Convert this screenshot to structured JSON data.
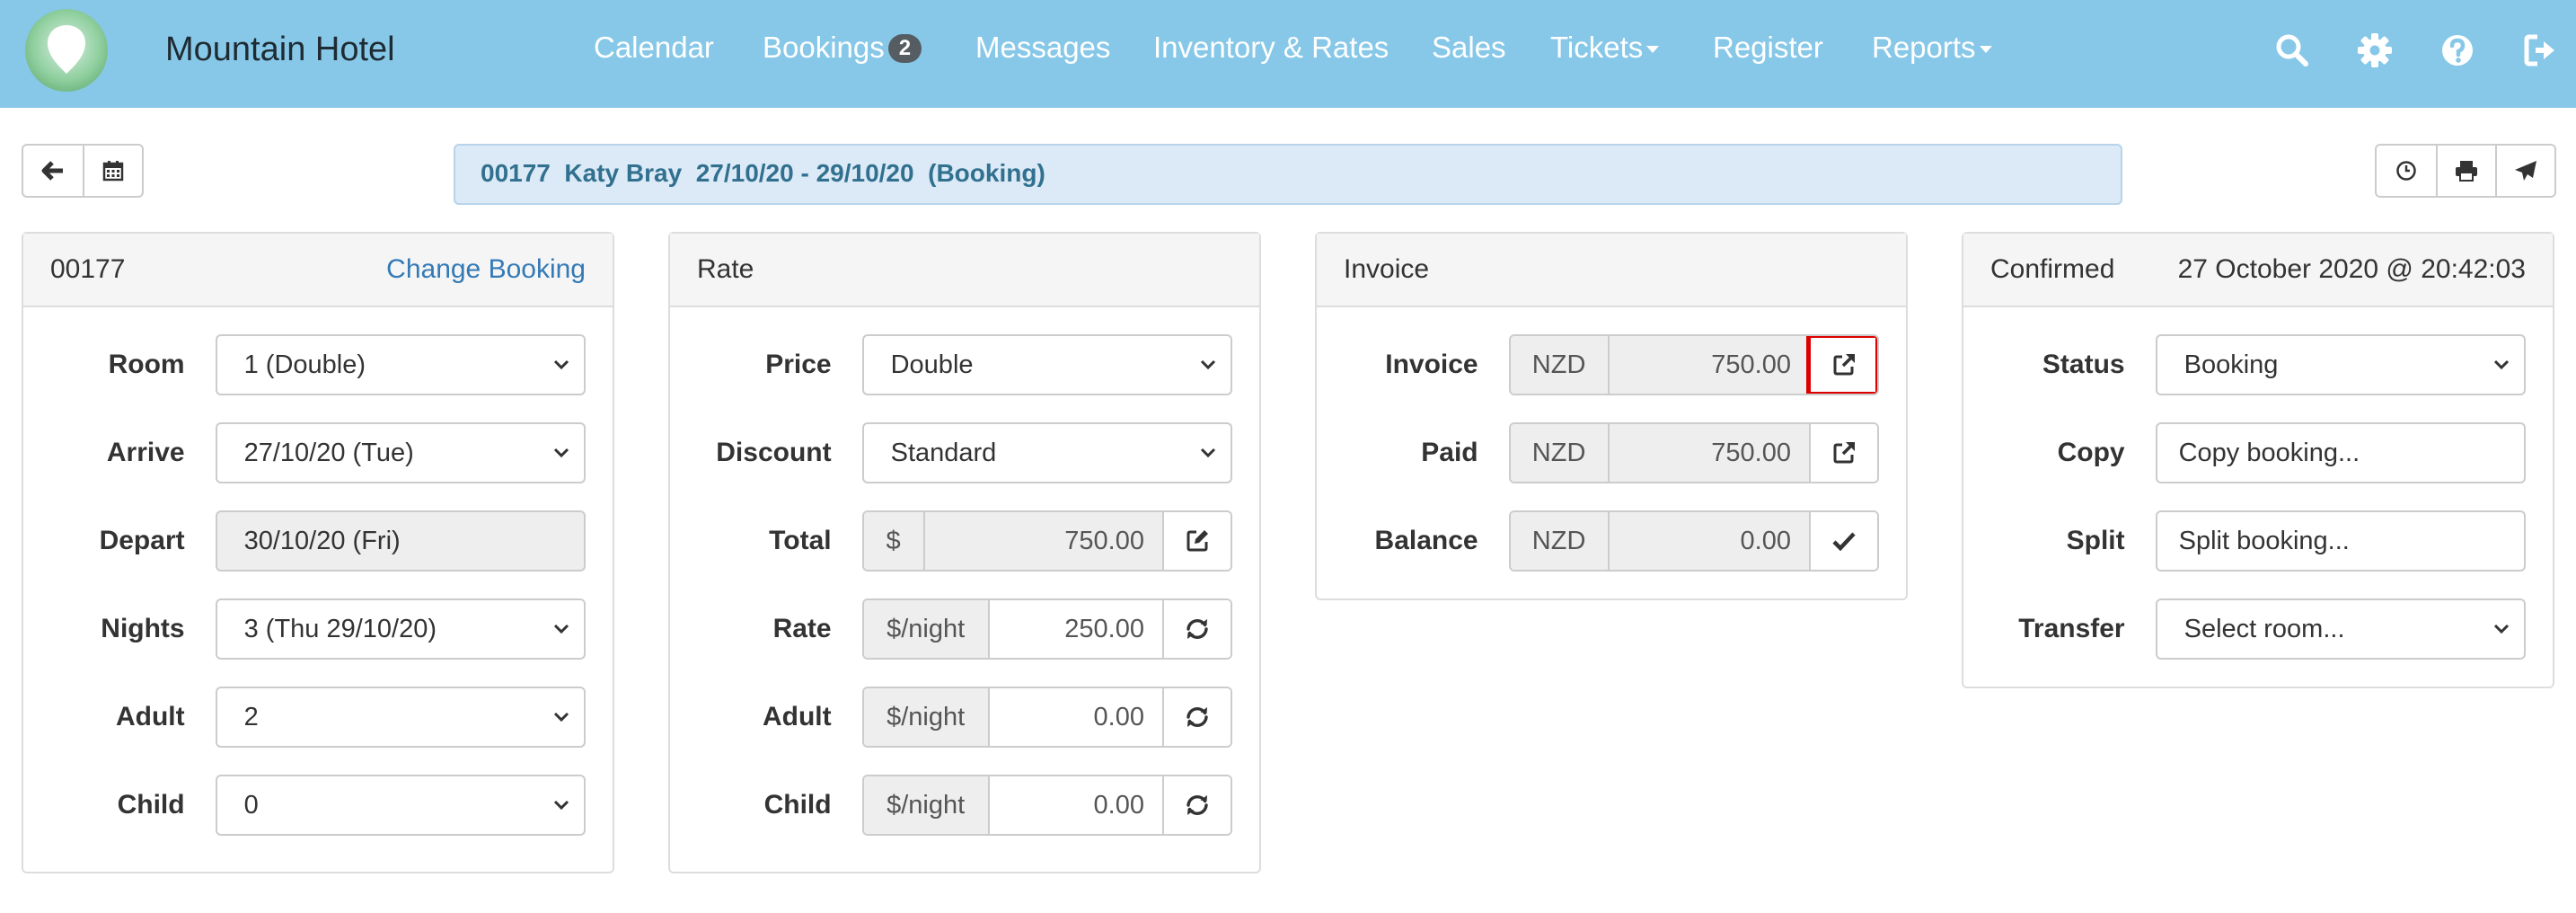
{
  "app": {
    "name": "Mountain Hotel",
    "nav": [
      {
        "label": "Calendar"
      },
      {
        "label": "Bookings",
        "badge": "2"
      },
      {
        "label": "Messages"
      },
      {
        "label": "Inventory & Rates"
      },
      {
        "label": "Sales"
      },
      {
        "label": "Tickets",
        "dropdown": true
      },
      {
        "label": "Register"
      },
      {
        "label": "Reports",
        "dropdown": true
      }
    ],
    "nav_icons": [
      "search-icon",
      "gear-icon",
      "help-icon",
      "logout-icon"
    ]
  },
  "toolbar": {
    "left_icons": [
      "arrow-left-icon",
      "calendar-icon"
    ],
    "summary": "00177  Katy Bray  27/10/20 - 29/10/20  (Booking)",
    "right_icons": [
      "clock-icon",
      "print-icon",
      "send-icon"
    ]
  },
  "booking_panel": {
    "id": "00177",
    "change_link": "Change Booking",
    "fields": {
      "room": {
        "label": "Room",
        "value": "1 (Double)"
      },
      "arrive": {
        "label": "Arrive",
        "value": "27/10/20  (Tue)"
      },
      "depart": {
        "label": "Depart",
        "value": "30/10/20  (Fri)"
      },
      "nights": {
        "label": "Nights",
        "value": "3  (Thu 29/10/20)"
      },
      "adult": {
        "label": "Adult",
        "value": "2"
      },
      "child": {
        "label": "Child",
        "value": "0"
      }
    }
  },
  "rate_panel": {
    "title": "Rate",
    "price": {
      "label": "Price",
      "value": "Double"
    },
    "discount": {
      "label": "Discount",
      "value": "Standard"
    },
    "total": {
      "label": "Total",
      "addon": "$",
      "value": "750.00"
    },
    "rate": {
      "label": "Rate",
      "addon": "$/night",
      "value": "250.00"
    },
    "adult": {
      "label": "Adult",
      "addon": "$/night",
      "value": "0.00"
    },
    "child": {
      "label": "Child",
      "addon": "$/night",
      "value": "0.00"
    }
  },
  "invoice_panel": {
    "title": "Invoice",
    "invoice": {
      "label": "Invoice",
      "currency": "NZD",
      "value": "750.00"
    },
    "paid": {
      "label": "Paid",
      "currency": "NZD",
      "value": "750.00"
    },
    "balance": {
      "label": "Balance",
      "currency": "NZD",
      "value": "0.00"
    }
  },
  "status_panel": {
    "title": "Confirmed",
    "timestamp": "27 October 2020 @ 20:42:03",
    "status": {
      "label": "Status",
      "value": "Booking"
    },
    "copy": {
      "label": "Copy",
      "placeholder": "Copy booking..."
    },
    "split": {
      "label": "Split",
      "placeholder": "Split booking..."
    },
    "transfer": {
      "label": "Transfer",
      "value": "Select room..."
    }
  },
  "colors": {
    "navbar": "#87c8e8",
    "summary_bg": "#dbeaf6",
    "summary_text": "#31708f",
    "link": "#337ab7",
    "highlight": "#dd0000"
  }
}
